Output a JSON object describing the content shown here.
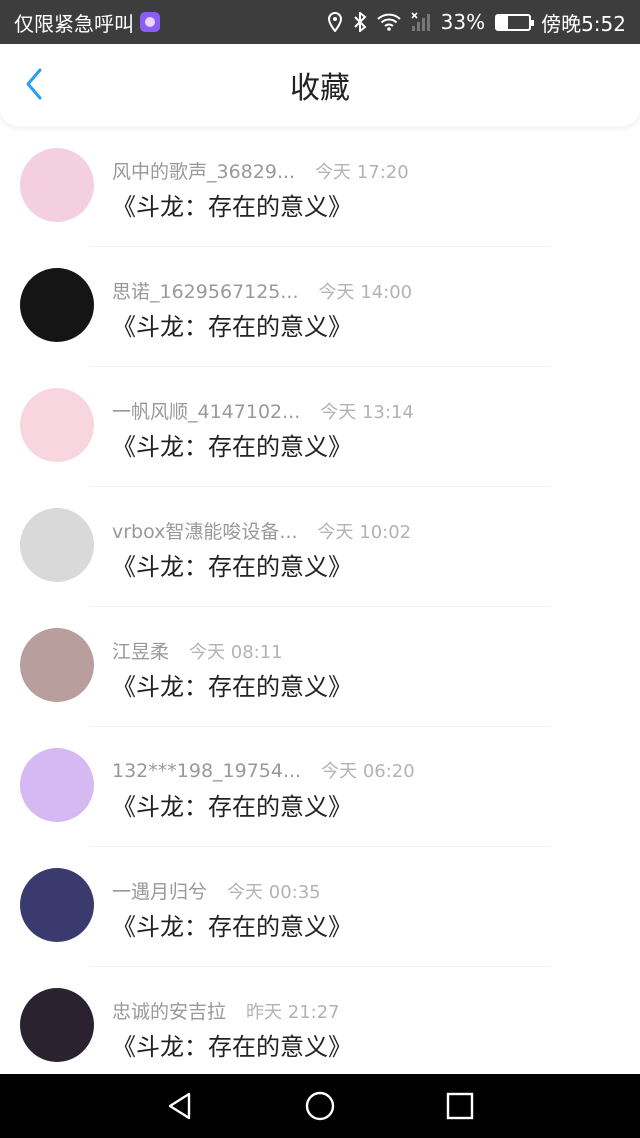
{
  "statusbar": {
    "emergency_label": "仅限紧急呼叫",
    "battery_percent": "33%",
    "clock": "傍晚5:52",
    "battery_level": 0.33,
    "icons": [
      "location-icon",
      "bluetooth-icon",
      "wifi-icon",
      "signal-icon",
      "battery-icon"
    ]
  },
  "header": {
    "title": "收藏",
    "back_icon": "chevron-left-icon",
    "accent": "#2a9df4"
  },
  "items": [
    {
      "username": "风中的歌声_36829...",
      "time": "今天 17:20",
      "title": "《斗龙：存在的意义》",
      "avatar_color": "#f4cfe0"
    },
    {
      "username": "思诺_1629567125...",
      "time": "今天 14:00",
      "title": "《斗龙：存在的意义》",
      "avatar_color": "#151515"
    },
    {
      "username": "一帆风顺_4147102...",
      "time": "今天 13:14",
      "title": "《斗龙：存在的意义》",
      "avatar_color": "#f7d6df"
    },
    {
      "username": "vrbox智潓能唆设备...",
      "time": "今天 10:02",
      "title": "《斗龙：存在的意义》",
      "avatar_color": "#d9d9d9"
    },
    {
      "username": "江昱柔",
      "time": "今天 08:11",
      "title": "《斗龙：存在的意义》",
      "avatar_color": "#b89e9c"
    },
    {
      "username": "132***198_19754...",
      "time": "今天 06:20",
      "title": "《斗龙：存在的意义》",
      "avatar_color": "#d6b9f2"
    },
    {
      "username": "一遇月归兮",
      "time": "今天 00:35",
      "title": "《斗龙：存在的意义》",
      "avatar_color": "#3a3a6e"
    },
    {
      "username": "忠诚的安吉拉",
      "time": "昨天 21:27",
      "title": "《斗龙：存在的意义》",
      "avatar_color": "#2b2230"
    }
  ],
  "navbar": {
    "icons": [
      "back-triangle-icon",
      "home-circle-icon",
      "recents-square-icon"
    ]
  }
}
